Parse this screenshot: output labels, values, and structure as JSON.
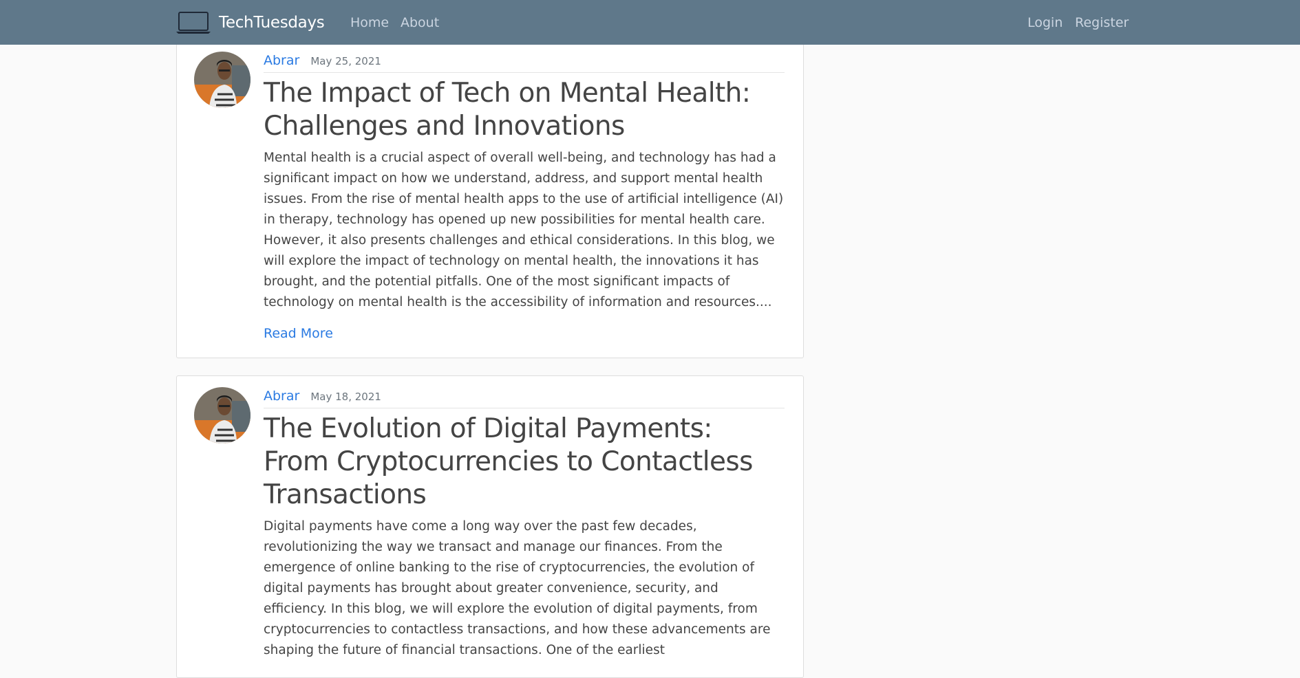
{
  "navbar": {
    "brand_icon": "laptop-icon",
    "brand": "TechTuesdays",
    "links": [
      "Home",
      "About"
    ],
    "auth_links": [
      "Login",
      "Register"
    ],
    "background": "#5f788a"
  },
  "posts": [
    {
      "author": "Abrar",
      "date": "May 25, 2021",
      "title": "The Impact of Tech on Mental Health: Challenges and Innovations",
      "excerpt": "Mental health is a crucial aspect of overall well-being, and technology has had a significant impact on how we understand, address, and support mental health issues. From the rise of mental health apps to the use of artificial intelligence (AI) in therapy, technology has opened up new possibilities for mental health care. However, it also presents challenges and ethical considerations. In this blog, we will explore the impact of technology on mental health, the innovations it has brought, and the potential pitfalls. One of the most significant impacts of technology on mental health is the accessibility of information and resources....",
      "read_more": "Read More"
    },
    {
      "author": "Abrar",
      "date": "May 18, 2021",
      "title": "The Evolution of Digital Payments: From Cryptocurrencies to Contactless Transactions",
      "excerpt": "Digital payments have come a long way over the past few decades, revolutionizing the way we transact and manage our finances. From the emergence of online banking to the rise of cryptocurrencies, the evolution of digital payments has brought about greater convenience, security, and efficiency. In this blog, we will explore the evolution of digital payments, from cryptocurrencies to contactless transactions, and how these advancements are shaping the future of financial transactions. One of the earliest"
    }
  ],
  "colors": {
    "link": "#2a7ae2",
    "text": "#444444",
    "page_background": "#fafafa"
  }
}
